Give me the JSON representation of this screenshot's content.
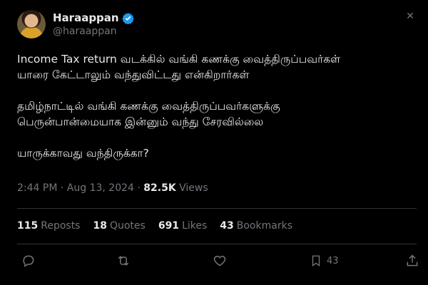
{
  "author": {
    "name": "Haraappan",
    "handle": "@haraappan",
    "verified_color": "#1d9bf0"
  },
  "body": {
    "para1": [
      "Income Tax return வடக்கில் வங்கி கணக்கு வைத்திருப்பவர்கள்",
      "யாரை கேட்டாலும் வந்துவிட்டது என்கிறார்கள்"
    ],
    "para2": [
      "தமிழ்நாட்டில் வங்கி கணக்கு வைத்திருப்பவர்களுக்கு",
      "பெருன்பான்மையாக இன்னும் வந்து சேரவில்லை"
    ],
    "para3": [
      "யாருக்காவது வந்திருக்கா?"
    ]
  },
  "meta": {
    "time": "2:44 PM",
    "sep": " · ",
    "date": "Aug 13, 2024",
    "views_count": "82.5K",
    "views_label": "Views"
  },
  "stats": {
    "reposts": {
      "count": "115",
      "label": "Reposts"
    },
    "quotes": {
      "count": "18",
      "label": "Quotes"
    },
    "likes": {
      "count": "691",
      "label": "Likes"
    },
    "bookmarks": {
      "count": "43",
      "label": "Bookmarks"
    }
  },
  "actions": {
    "reply_icon": "reply-icon",
    "repost_icon": "repost-icon",
    "like_icon": "heart-icon",
    "bookmark_icon": "bookmark-icon",
    "bookmark_count": "43",
    "share_icon": "share-icon"
  },
  "colors": {
    "background": "#000000",
    "text": "#e7e9ea",
    "muted": "#71767b",
    "divider": "#2f3336"
  }
}
